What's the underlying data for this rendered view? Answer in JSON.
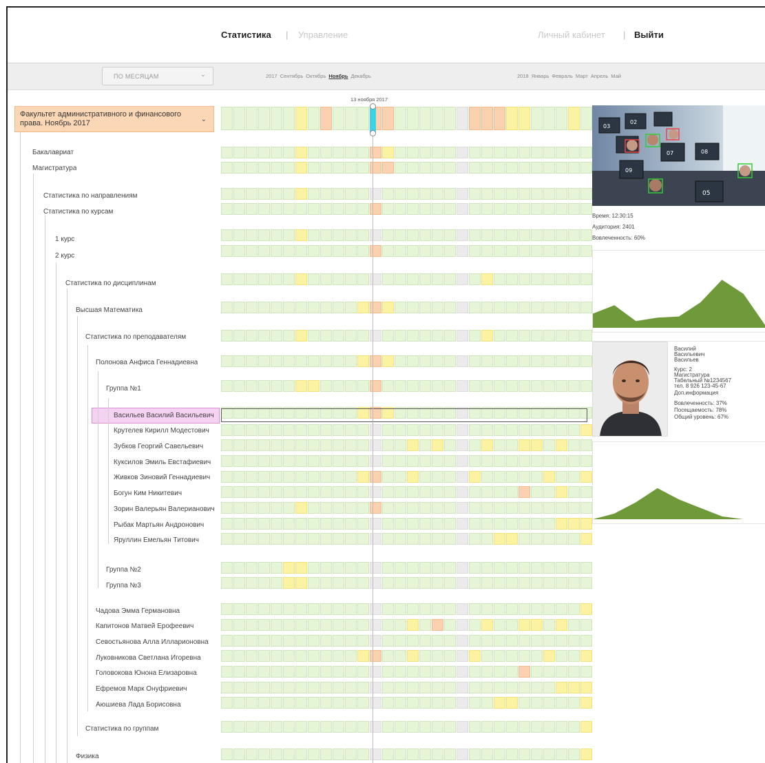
{
  "nav": {
    "stats": "Статистика",
    "sep1": "|",
    "manage": "Управление",
    "cabinet": "Личный кабинет",
    "sep2": "|",
    "exit": "Выйти"
  },
  "filter": {
    "period_value": "ПО МЕСЯЦАМ",
    "months_2017": [
      "2017",
      "Сентябрь",
      "Октябрь",
      "Ноябрь",
      "Декабрь"
    ],
    "active_month": "Ноябрь",
    "months_2018": [
      "2018",
      "Январь",
      "Февраль",
      "Март",
      "Апрель",
      "Май"
    ]
  },
  "timeline": {
    "date": "13 ноября 2017"
  },
  "tree": {
    "faculty": "Факультет административного и финансового права. Ноябрь 2017",
    "bachelor": "Бакалавриат",
    "master": "Магистратура",
    "by_direction": "Статистика по направлениям",
    "by_course": "Статистика по курсам",
    "course1": "1 курс",
    "course2": "2 курс",
    "by_discipline": "Статистика по дисциплинам",
    "math": "Высшая Математика",
    "by_teacher": "Статистика по преподавателям",
    "teacher1": "Полонова Анфиса Геннадиевна",
    "group1": "Группа №1",
    "students": [
      "Васильев Василий Васильевич",
      "Крутелев Кирилл Модестович",
      "Зубков Георгий Савельевич",
      "Куксилов Эмиль Евстафиевич",
      "Живков Зиновий Геннадиевич",
      "Богун Ким Никитевич",
      "Зорин Валерьян Валерианович",
      "Рыбак Мартьян Андронович",
      "Яруллин Емельян Титович"
    ],
    "group2": "Группа №2",
    "group3": "Группа №3",
    "teachers": [
      "Чадова Эмма Германовна",
      "Капитонов Матвей Ерофеевич",
      "Севостьянова Алла Илларионовна",
      "Луковникова Светлана Игоревна",
      "Головокова Юнона Елизаровна",
      "Ефремов Марк Онуфриевич",
      "Аюшиева Лада Борисовна"
    ],
    "by_group": "Статистика по группам",
    "physics": "Физика"
  },
  "colors": {
    "cell_normal": "#e6f5d6",
    "cell_empty": "#ebebeb",
    "cell_warning": "#fbf3a1",
    "cell_alert": "#fbd2b0",
    "faculty_bg": "#fbd7b6",
    "selected_row": "#f6d2f2",
    "chart_fill": "#6f9a3a",
    "today_marker": "#3fd1e4"
  },
  "grid_rows": [
    {
      "key": "faculty",
      "g": [
        12,
        19
      ],
      "y": [
        6,
        23,
        24,
        28
      ],
      "o": [
        8,
        12,
        13,
        20,
        21,
        22
      ],
      "s": []
    },
    {
      "key": "bachelor",
      "g": [
        12,
        19
      ],
      "y": [
        6,
        13
      ],
      "o": [
        12
      ],
      "s": []
    },
    {
      "key": "master",
      "g": [
        12,
        19
      ],
      "y": [
        6
      ],
      "o": [
        12,
        13
      ],
      "s": []
    },
    {
      "key": "by_direction",
      "g": [
        12,
        19
      ],
      "y": [
        6
      ],
      "o": [],
      "s": []
    },
    {
      "key": "by_course",
      "g": [
        12,
        19
      ],
      "y": [],
      "o": [
        12
      ],
      "s": []
    },
    {
      "key": "course1",
      "g": [
        12,
        19
      ],
      "y": [
        6
      ],
      "o": [],
      "s": []
    },
    {
      "key": "course2",
      "g": [
        12,
        19
      ],
      "y": [],
      "o": [
        12
      ],
      "s": []
    },
    {
      "key": "by_discipline",
      "g": [
        12,
        19
      ],
      "y": [
        6,
        21
      ],
      "o": [],
      "s": []
    },
    {
      "key": "math",
      "g": [
        12,
        19
      ],
      "y": [
        11,
        13
      ],
      "o": [
        12
      ],
      "s": []
    },
    {
      "key": "by_teacher",
      "g": [
        12,
        19
      ],
      "y": [
        6,
        21
      ],
      "o": [],
      "s": []
    },
    {
      "key": "teacher1",
      "g": [
        12,
        19
      ],
      "y": [
        11,
        13
      ],
      "o": [
        12
      ],
      "s": []
    },
    {
      "key": "group1",
      "g": [
        12,
        19
      ],
      "y": [
        6,
        7
      ],
      "o": [
        12
      ],
      "s": []
    },
    {
      "key": "student0",
      "g": [
        12,
        19
      ],
      "y": [
        11,
        13
      ],
      "o": [
        12
      ],
      "s": []
    },
    {
      "key": "student1",
      "g": [
        12,
        19
      ],
      "y": [
        29
      ],
      "o": [],
      "s": []
    },
    {
      "key": "student2",
      "g": [
        12,
        19
      ],
      "y": [
        15,
        17,
        21,
        24,
        25,
        27
      ],
      "o": [],
      "s": []
    },
    {
      "key": "student3",
      "g": [
        12,
        19
      ],
      "y": [],
      "o": [],
      "s": []
    },
    {
      "key": "student4",
      "g": [
        12,
        19
      ],
      "y": [
        11,
        15,
        20,
        26,
        29
      ],
      "o": [
        12
      ],
      "s": []
    },
    {
      "key": "student5",
      "g": [
        12,
        19
      ],
      "y": [
        27
      ],
      "o": [
        24
      ],
      "s": []
    },
    {
      "key": "student6",
      "g": [
        12,
        19
      ],
      "y": [
        6
      ],
      "o": [
        12
      ],
      "s": []
    },
    {
      "key": "student7",
      "g": [
        12,
        19
      ],
      "y": [
        27,
        28,
        29
      ],
      "o": [],
      "s": []
    },
    {
      "key": "student8",
      "g": [
        12,
        19
      ],
      "y": [
        22,
        23,
        29
      ],
      "o": [],
      "s": []
    },
    {
      "key": "group2",
      "g": [
        12,
        19
      ],
      "y": [
        5,
        6
      ],
      "o": [],
      "s": []
    },
    {
      "key": "group3",
      "g": [
        12,
        19
      ],
      "y": [
        5,
        6
      ],
      "o": [],
      "s": []
    },
    {
      "key": "teachers0",
      "g": [
        12,
        19
      ],
      "y": [
        29
      ],
      "o": [],
      "s": []
    },
    {
      "key": "teachers1",
      "g": [
        12,
        19
      ],
      "y": [
        15,
        17,
        21,
        24,
        25,
        27
      ],
      "o": [
        17
      ],
      "s": []
    },
    {
      "key": "teachers2",
      "g": [
        12,
        19
      ],
      "y": [],
      "o": [],
      "s": []
    },
    {
      "key": "teachers3",
      "g": [
        12,
        19
      ],
      "y": [
        11,
        15,
        20,
        26,
        29
      ],
      "o": [
        12
      ],
      "s": []
    },
    {
      "key": "teachers4",
      "g": [
        12,
        19
      ],
      "y": [],
      "o": [
        24
      ],
      "s": []
    },
    {
      "key": "teachers5",
      "g": [
        12,
        19
      ],
      "y": [
        27,
        28,
        29
      ],
      "o": [],
      "s": []
    },
    {
      "key": "teachers6",
      "g": [
        12,
        19
      ],
      "y": [
        22,
        23,
        29
      ],
      "o": [],
      "s": []
    },
    {
      "key": "by_group",
      "g": [
        12,
        19
      ],
      "y": [
        29
      ],
      "o": [],
      "s": []
    },
    {
      "key": "physics",
      "g": [
        12,
        19
      ],
      "y": [
        29
      ],
      "o": [],
      "s": []
    }
  ],
  "room_info": {
    "time": "Время: 12:30:15",
    "room": "Аудитория: 2401",
    "engagement": "Вовлеченность: 60%",
    "labels": [
      "03",
      "02",
      "07",
      "08",
      "09",
      "05"
    ]
  },
  "engagement_chart": {
    "type": "area",
    "values": [
      0.25,
      0.4,
      0.12,
      0.18,
      0.2,
      0.45,
      0.85,
      0.6,
      0.05
    ]
  },
  "student": {
    "name": [
      "Василий",
      "Васильевич",
      "Васильев"
    ],
    "course": "Курс: 2",
    "program": "Магистратура",
    "tab": "Табельный №1234567",
    "phone": "тел. 8 926 123-45-67",
    "more": "Доп.информация",
    "engagement": "Вовлеченность: 37%",
    "attendance": "Посещаемость: 78%",
    "overall": "Общий уровень: 67%"
  },
  "student_chart": {
    "type": "area",
    "values": [
      0,
      0.1,
      0.3,
      0.55,
      0.35,
      0.2,
      0.05,
      0,
      0
    ]
  }
}
